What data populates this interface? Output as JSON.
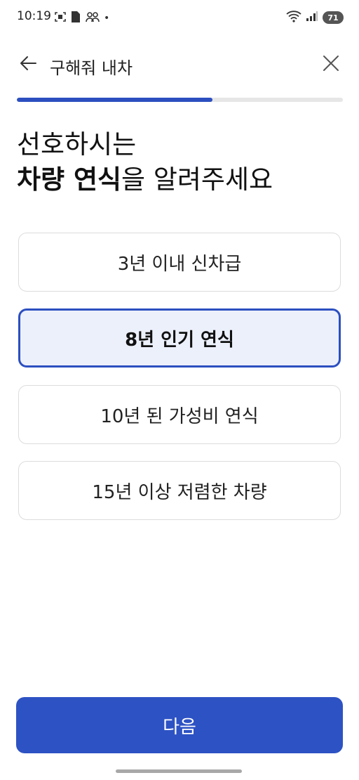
{
  "status_bar": {
    "time": "10:19",
    "dot": "•",
    "battery": "71",
    "left_icons": [
      "screenshot-icon",
      "sim-icon",
      "people-icon"
    ],
    "right_icons": [
      "wifi-icon",
      "signal-icon",
      "battery-icon"
    ]
  },
  "app_bar": {
    "title": "구해줘 내차",
    "back_icon": "arrow-left-icon",
    "close_icon": "close-icon"
  },
  "progress": {
    "fraction": 0.6,
    "fill_color": "#2c4fc0"
  },
  "heading": {
    "line1": "선호하시는",
    "line2_bold": "차량 연식",
    "line2_rest": "을 알려주세요"
  },
  "options": [
    {
      "label": "3년 이내 신차급",
      "selected": false
    },
    {
      "label": "8년 인기 연식",
      "selected": true
    },
    {
      "label": "10년 된 가성비 연식",
      "selected": false
    },
    {
      "label": "15년 이상 저렴한 차량",
      "selected": false
    }
  ],
  "next_button": {
    "label": "다음",
    "color": "#2d52c4"
  }
}
